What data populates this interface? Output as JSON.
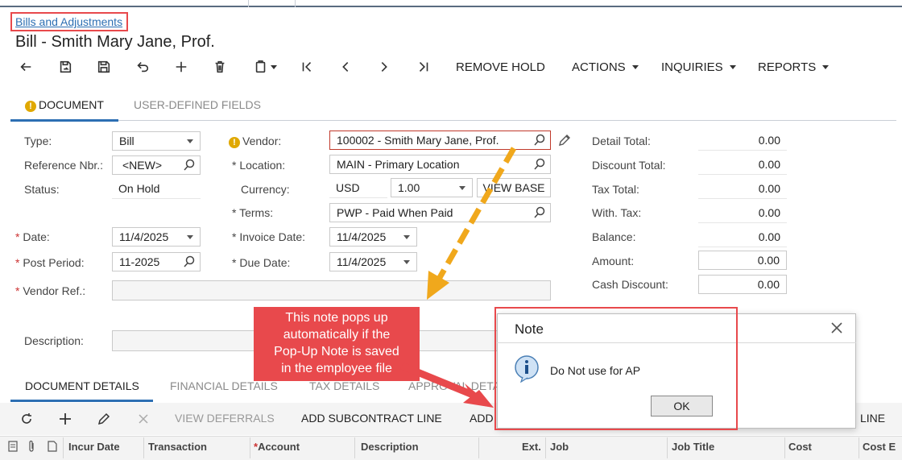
{
  "breadcrumb": "Bills and Adjustments",
  "title": "Bill - Smith Mary Jane, Prof.",
  "toolbar": {
    "remove_hold": "REMOVE HOLD",
    "actions": "ACTIONS",
    "inquiries": "INQUIRIES",
    "reports": "REPORTS"
  },
  "tabs": {
    "document": "DOCUMENT",
    "user_defined": "USER-DEFINED FIELDS"
  },
  "form": {
    "type_label": "Type:",
    "type_value": "Bill",
    "refnbr_label": "Reference Nbr.:",
    "refnbr_value": "<NEW>",
    "status_label": "Status:",
    "status_value": "On Hold",
    "date_label": "Date:",
    "date_value": "11/4/2025",
    "postperiod_label": "Post Period:",
    "postperiod_value": "11-2025",
    "vendorref_label": "Vendor Ref.:",
    "description_label": "Description:",
    "vendor_label": "Vendor:",
    "vendor_value": "100002 - Smith Mary Jane, Prof.",
    "location_label": "Location:",
    "location_value": "MAIN - Primary Location",
    "currency_label": "Currency:",
    "currency_value": "USD",
    "rate_value": "1.00",
    "view_base": "VIEW BASE",
    "terms_label": "Terms:",
    "terms_value": "PWP - Paid When Paid",
    "invoicedate_label": "Invoice Date:",
    "invoicedate_value": "11/4/2025",
    "duedate_label": "Due Date:",
    "duedate_value": "11/4/2025"
  },
  "totals": {
    "detail_total_label": "Detail Total:",
    "detail_total": "0.00",
    "discount_total_label": "Discount Total:",
    "discount_total": "0.00",
    "tax_total_label": "Tax Total:",
    "tax_total": "0.00",
    "with_tax_label": "With. Tax:",
    "with_tax": "0.00",
    "balance_label": "Balance:",
    "balance": "0.00",
    "amount_label": "Amount:",
    "amount": "0.00",
    "cash_discount_label": "Cash Discount:",
    "cash_discount": "0.00"
  },
  "callout": {
    "line1": "This note pops up",
    "line2": "automatically if the",
    "line3": "Pop-Up Note is saved",
    "line4": "in the employee file"
  },
  "modal": {
    "title": "Note",
    "message": "Do Not use for AP",
    "ok": "OK"
  },
  "bottom_tabs": {
    "document_details": "DOCUMENT DETAILS",
    "financial_details": "FINANCIAL DETAILS",
    "tax_details": "TAX DETAILS",
    "approval_details": "APPROVAL DETA"
  },
  "bottom_toolbar": {
    "view_deferrals": "VIEW DEFERRALS",
    "add_subcontract_line": "ADD SUBCONTRACT LINE",
    "add_partial": "ADD P",
    "line_partial": "LINE"
  },
  "grid_columns": {
    "incur_date": "Incur Date",
    "transaction": "Transaction",
    "account": "Account",
    "description": "Description",
    "ext": "Ext.",
    "job": "Job",
    "job_title": "Job Title",
    "cost": "Cost",
    "cost_e": "Cost E"
  },
  "colors": {
    "accent": "#2d6fb3",
    "highlight_red": "#e8494c",
    "arrow_orange": "#f0a81c",
    "warning": "#e0a800"
  }
}
